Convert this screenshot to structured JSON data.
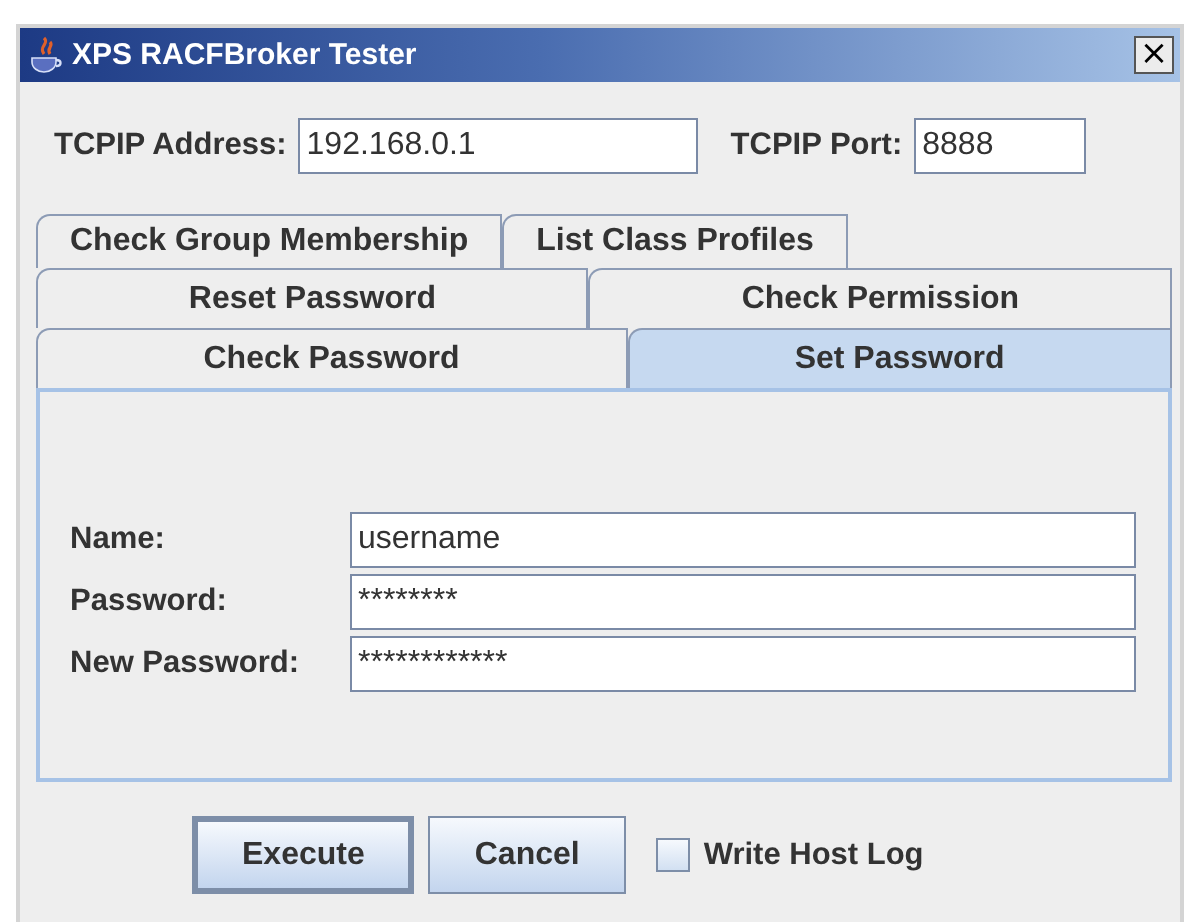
{
  "window": {
    "title": "XPS RACFBroker Tester",
    "close": "×"
  },
  "connection": [
    {
      "label": "TCPIP Address:",
      "value": "192.168.0.1",
      "kind": "wide"
    },
    {
      "label": "TCPIP Port:",
      "value": "8888",
      "kind": "narrow"
    }
  ],
  "tab_rows": [
    [
      {
        "label": "Check Group Membership",
        "selected": false
      },
      {
        "label": "List Class Profiles",
        "selected": false
      }
    ],
    [
      {
        "label": "Reset Password",
        "selected": false
      },
      {
        "label": "Check Permission",
        "selected": false
      }
    ],
    [
      {
        "label": "Check Password",
        "selected": false
      },
      {
        "label": "Set Password",
        "selected": true
      }
    ]
  ],
  "form": [
    {
      "label": "Name:",
      "value": "username"
    },
    {
      "label": "Password:",
      "value": "********"
    },
    {
      "label": "New Password:",
      "value": "************"
    }
  ],
  "buttons": [
    {
      "label": "Execute",
      "default": true
    },
    {
      "label": "Cancel",
      "default": false
    }
  ],
  "write_host_log": {
    "label": "Write Host Log",
    "checked": false
  }
}
